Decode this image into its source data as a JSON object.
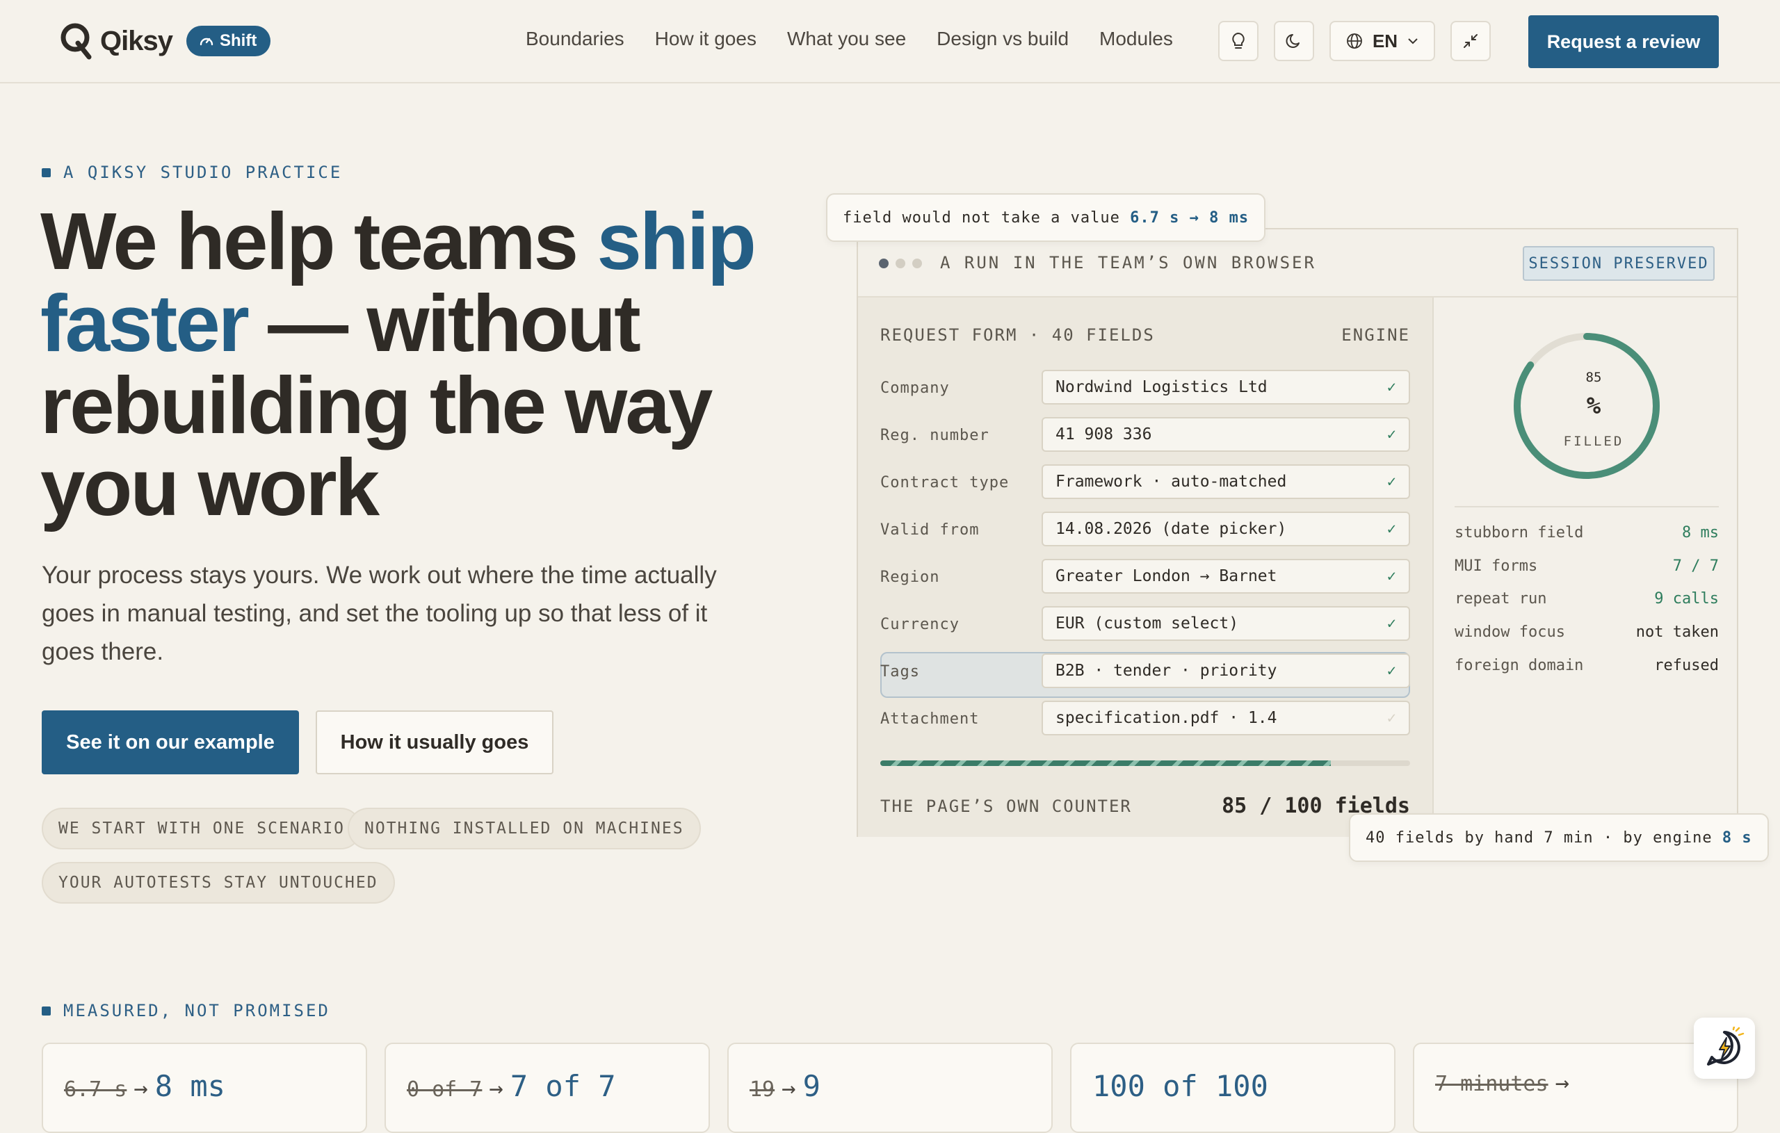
{
  "header": {
    "brand": "Qiksy",
    "badge": "Shift",
    "nav": [
      "Boundaries",
      "How it goes",
      "What you see",
      "Design vs build",
      "Modules"
    ],
    "lang": "EN",
    "cta": "Request a review"
  },
  "hero": {
    "eyebrow": "A QIKSY STUDIO PRACTICE",
    "title_1": "We help teams ",
    "title_accent_1": "ship",
    "title_accent_2": "faster",
    "title_2": " — without rebuilding the way you work",
    "lead": "Your process stays yours. We work out where the time actually goes in manual testing, and set the tooling up so that less of it goes there.",
    "primary_button": "See it on our example",
    "secondary_button": "How it usually goes",
    "pills": [
      "WE START WITH ONE SCENARIO",
      "NOTHING INSTALLED ON MACHINES",
      "YOUR AUTOTESTS STAY UNTOUCHED"
    ]
  },
  "demo": {
    "callout_top_text": "field would not take a value",
    "callout_top_value": "6.7 s → 8 ms",
    "window_title": "A RUN IN THE TEAM’S OWN BROWSER",
    "session_badge": "SESSION PRESERVED",
    "form_title": "REQUEST FORM · 40 FIELDS",
    "engine_label": "ENGINE",
    "rows": [
      {
        "label": "Company",
        "value": "Nordwind Logistics Ltd",
        "checked": true
      },
      {
        "label": "Reg. number",
        "value": "41 908 336",
        "checked": true
      },
      {
        "label": "Contract type",
        "value": "Framework · auto-matched",
        "checked": true
      },
      {
        "label": "Valid from",
        "value": "14.08.2026 (date picker)",
        "checked": true
      },
      {
        "label": "Region",
        "value": "Greater London → Barnet",
        "checked": true
      },
      {
        "label": "Currency",
        "value": "EUR (custom select)",
        "checked": true
      },
      {
        "label": "Tags",
        "value": "B2B · tender · priority",
        "checked": true
      },
      {
        "label": "Attachment",
        "value": "specification.pdf · 1.4",
        "checked": false
      }
    ],
    "progress_fraction": 0.85,
    "counter_label": "THE PAGE’S OWN COUNTER",
    "counter_value": "85 / 100 fields",
    "gauge_number": "85",
    "gauge_unit": "%",
    "gauge_label": "FILLED",
    "gauge_fraction": 0.85,
    "stats": [
      {
        "k": "stubborn field",
        "v": "8 ms",
        "accent": true
      },
      {
        "k": "MUI forms",
        "v": "7 / 7",
        "accent": true
      },
      {
        "k": "repeat run",
        "v": "9 calls",
        "accent": true
      },
      {
        "k": "window focus",
        "v": "not taken",
        "accent": false
      },
      {
        "k": "foreign domain",
        "v": "refused",
        "accent": false
      }
    ],
    "callout_bottom_text": "40 fields by hand 7 min · by engine",
    "callout_bottom_value": "8 s"
  },
  "measured": {
    "eyebrow": "MEASURED, NOT PROMISED",
    "cards": [
      {
        "old": "6.7 s",
        "new": "8 ms"
      },
      {
        "old": "0 of 7",
        "new": "7 of 7"
      },
      {
        "old": "19",
        "new": "9"
      },
      {
        "old": "",
        "new": "100 of 100"
      },
      {
        "old": "7 minutes",
        "new": ""
      }
    ]
  },
  "colors": {
    "accent": "#245e85",
    "success": "#2e7d5d",
    "background": "#f5f2eb"
  },
  "icons": [
    "qiksy-logo-icon",
    "gauge-icon",
    "lightbulb-icon",
    "moon-icon",
    "globe-icon",
    "chevron-down-icon",
    "collapse-icon",
    "check-icon",
    "chat-bolt-icon"
  ]
}
